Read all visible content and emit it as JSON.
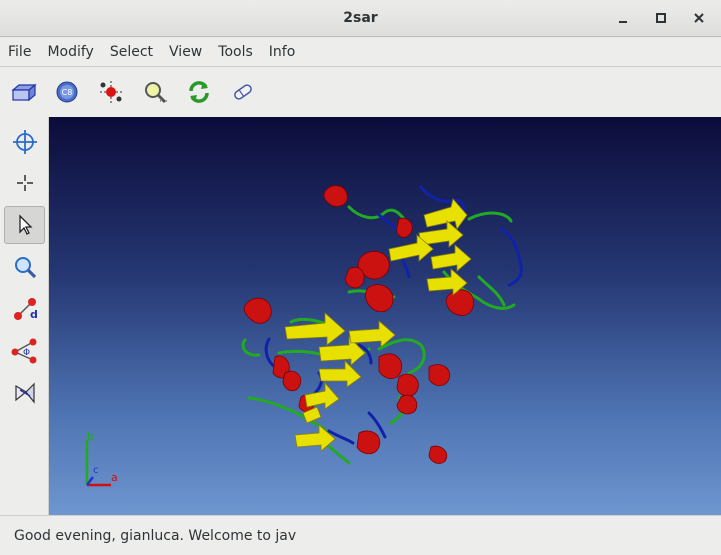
{
  "window": {
    "title": "2sar"
  },
  "menu": {
    "items": [
      "File",
      "Modify",
      "Select",
      "View",
      "Tools",
      "Info"
    ]
  },
  "toolbar": {
    "buttons": [
      {
        "name": "box-icon"
      },
      {
        "name": "cd-icon"
      },
      {
        "name": "atom-select-icon"
      },
      {
        "name": "zoom-icon"
      },
      {
        "name": "refresh-icon"
      },
      {
        "name": "eraser-icon"
      }
    ]
  },
  "sidebar": {
    "tools": [
      {
        "name": "crosshair-icon",
        "active": false
      },
      {
        "name": "move-icon",
        "active": false
      },
      {
        "name": "pointer-icon",
        "active": true
      },
      {
        "name": "magnify-icon",
        "active": false
      },
      {
        "name": "distance-icon",
        "active": false
      },
      {
        "name": "angle-icon",
        "active": false
      },
      {
        "name": "dihedral-icon",
        "active": false
      }
    ]
  },
  "viewer": {
    "axes": {
      "b": "b",
      "c": "c",
      "a": "a"
    },
    "colors": {
      "helix": "#cc1111",
      "sheet": "#e8e000",
      "coil": "#22aa22",
      "turn": "#1122aa"
    }
  },
  "status": {
    "text": "Good evening, gianluca.  Welcome to jav"
  }
}
